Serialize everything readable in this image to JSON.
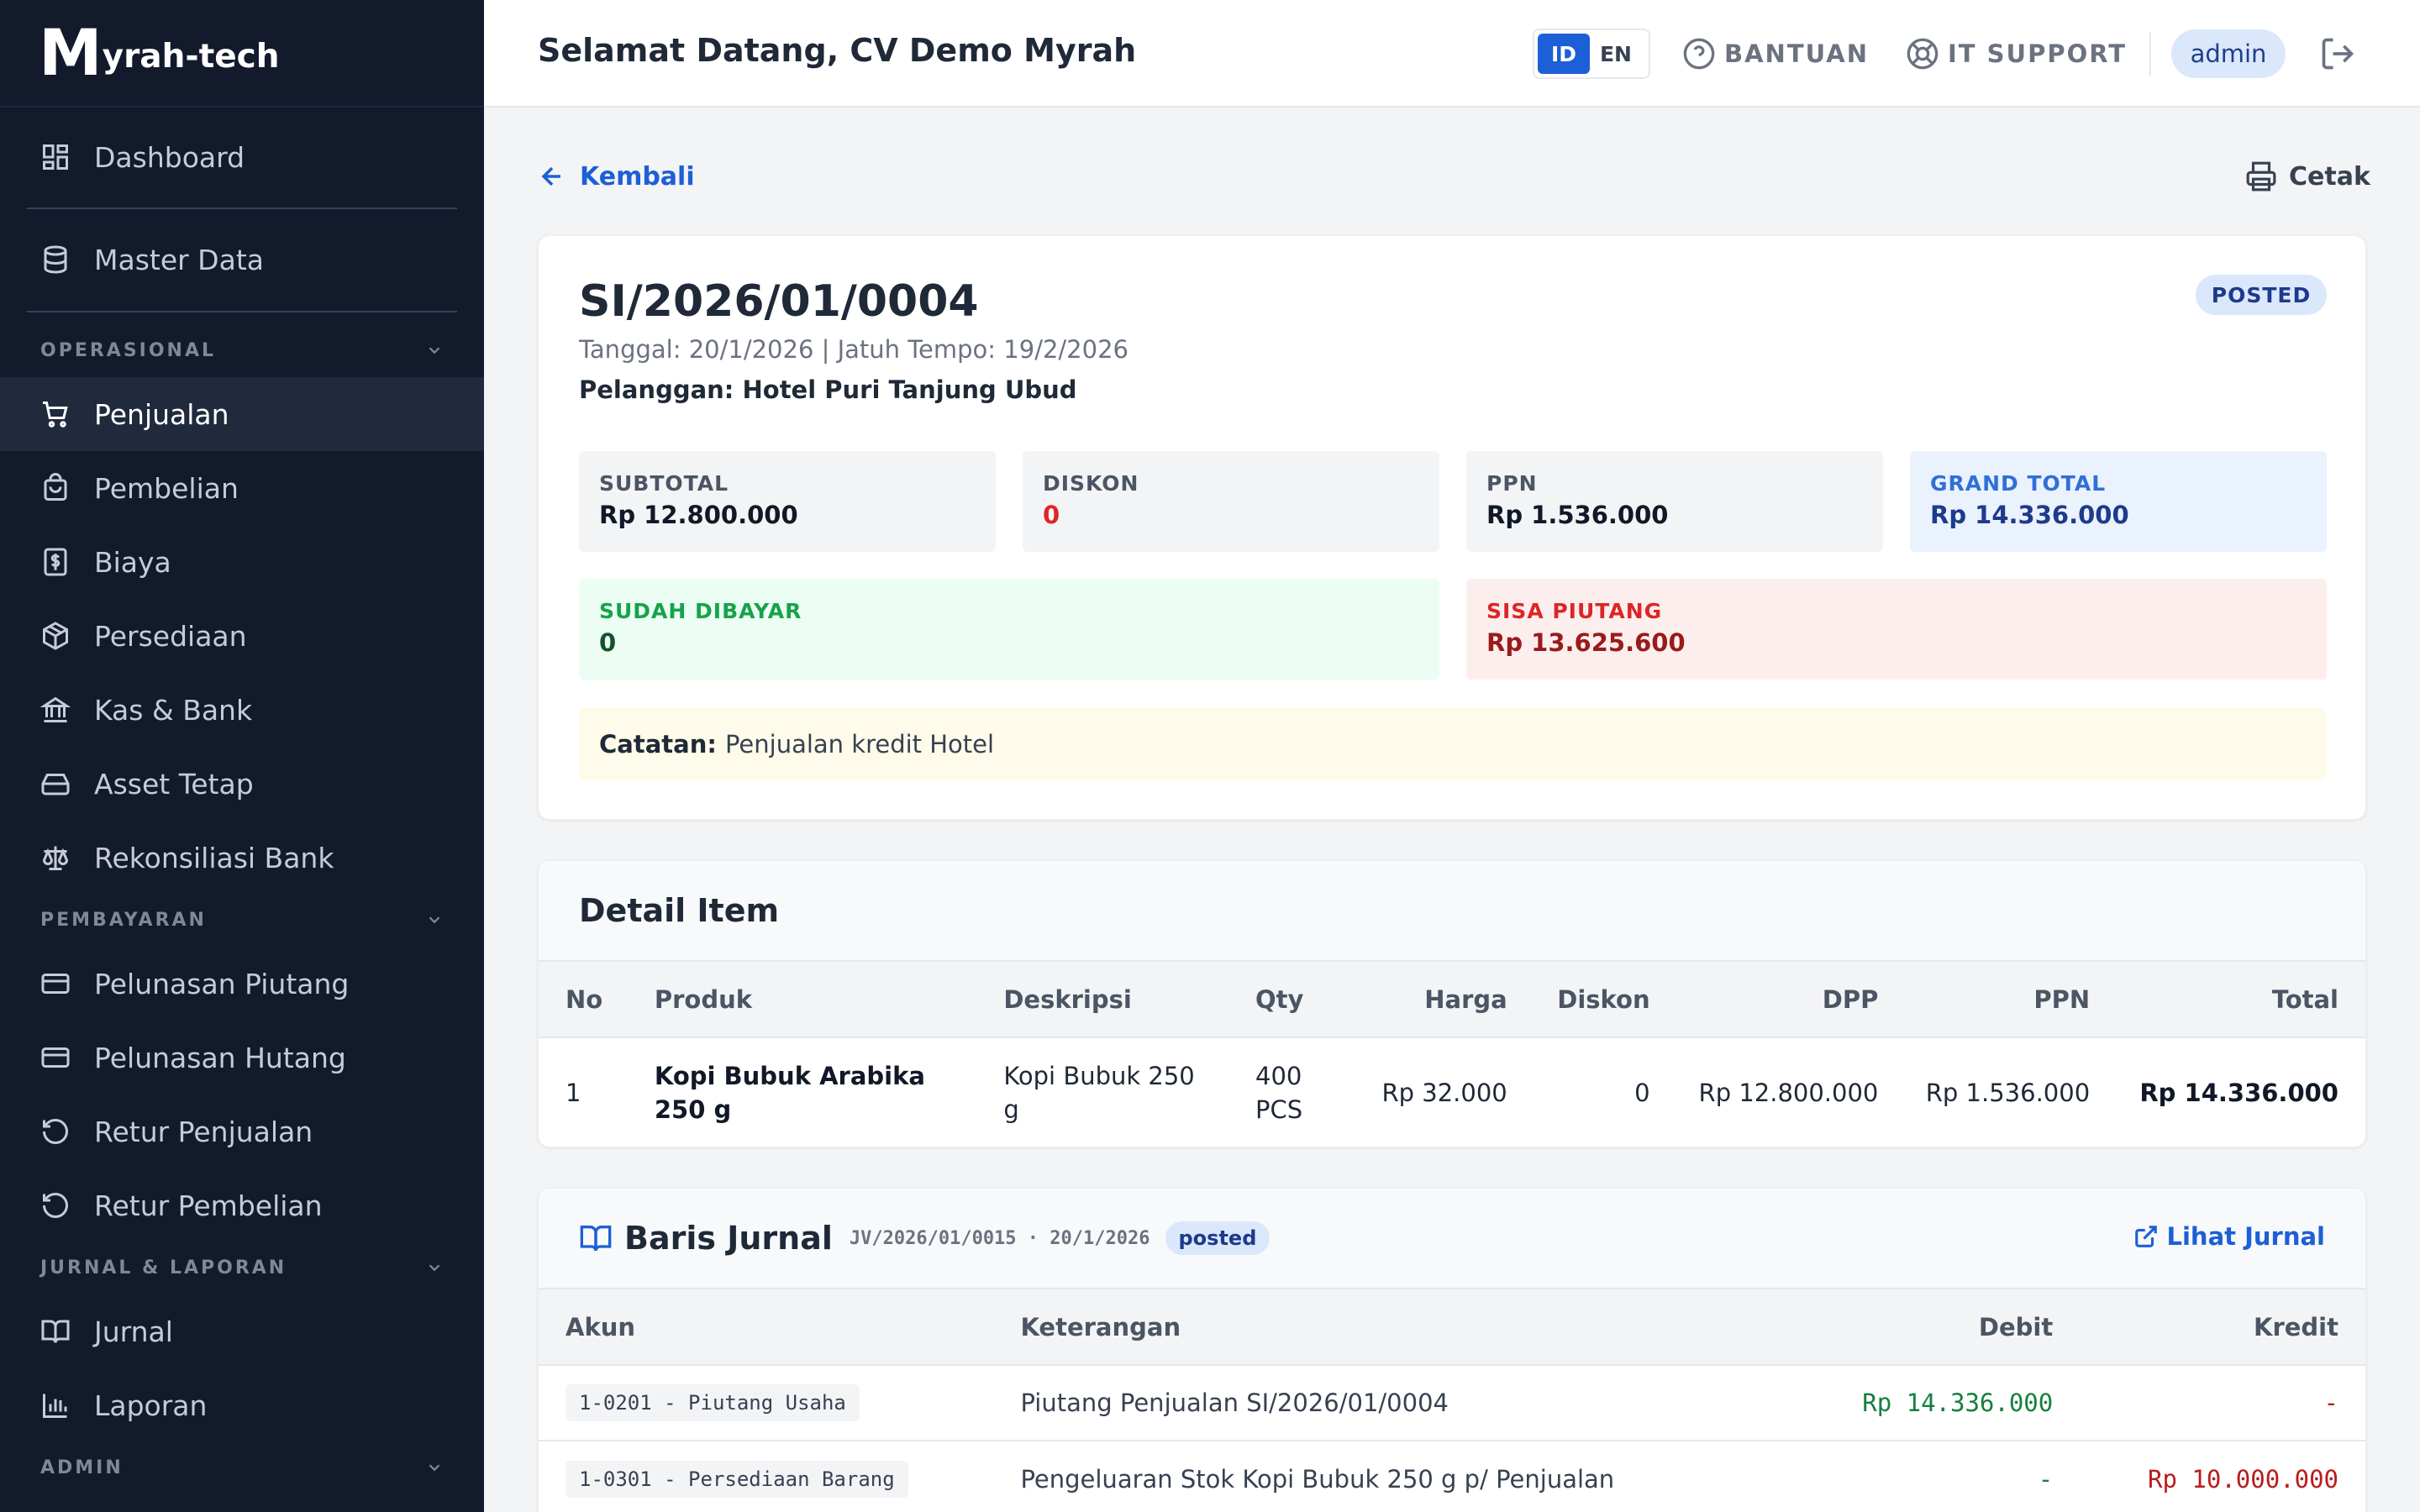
{
  "brand": {
    "logo_letter": "M",
    "name": "yrah-tech"
  },
  "sidebar": {
    "top_items": [
      {
        "label": "Dashboard",
        "icon": "grid-icon"
      },
      {
        "label": "Master Data",
        "icon": "database-icon"
      }
    ],
    "sections": [
      {
        "title": "OPERASIONAL",
        "items": [
          "Penjualan",
          "Pembelian",
          "Biaya",
          "Persediaan",
          "Kas & Bank",
          "Asset Tetap",
          "Rekonsiliasi Bank"
        ]
      },
      {
        "title": "PEMBAYARAN",
        "items": [
          "Pelunasan Piutang",
          "Pelunasan Hutang",
          "Retur Penjualan",
          "Retur Pembelian"
        ]
      },
      {
        "title": "JURNAL & LAPORAN",
        "items": [
          "Jurnal",
          "Laporan"
        ]
      },
      {
        "title": "ADMIN",
        "items": []
      }
    ],
    "active_item": "Penjualan"
  },
  "header": {
    "welcome": "Selamat Datang, CV Demo Myrah",
    "lang": {
      "id": "ID",
      "en": "EN",
      "active": "ID"
    },
    "help_label": "BANTUAN",
    "support_label": "IT SUPPORT",
    "user": "admin"
  },
  "actions": {
    "back_label": "Kembali",
    "print_label": "Cetak"
  },
  "invoice": {
    "number": "SI/2026/01/0004",
    "dates": "Tanggal: 20/1/2026 | Jatuh Tempo: 19/2/2026",
    "customer": "Pelanggan: Hotel Puri Tanjung Ubud",
    "status": "POSTED",
    "summary": {
      "subtotal_label": "SUBTOTAL",
      "subtotal": "Rp 12.800.000",
      "discount_label": "DISKON",
      "discount": "0",
      "ppn_label": "PPN",
      "ppn": "Rp 1.536.000",
      "grand_label": "GRAND TOTAL",
      "grand": "Rp 14.336.000",
      "paid_label": "SUDAH DIBAYAR",
      "paid": "0",
      "remaining_label": "SISA PIUTANG",
      "remaining": "Rp 13.625.600"
    },
    "note_label": "Catatan:",
    "note": "Penjualan kredit Hotel"
  },
  "detail": {
    "title": "Detail Item",
    "columns": {
      "no": "No",
      "product": "Produk",
      "desc": "Deskripsi",
      "qty": "Qty",
      "price": "Harga",
      "disc": "Diskon",
      "dpp": "DPP",
      "ppn": "PPN",
      "total": "Total"
    },
    "rows": [
      {
        "no": "1",
        "product": "Kopi Bubuk Arabika 250 g",
        "desc": "Kopi Bubuk 250 g",
        "qty": "400 PCS",
        "price": "Rp 32.000",
        "disc": "0",
        "dpp": "Rp 12.800.000",
        "ppn": "Rp 1.536.000",
        "total": "Rp 14.336.000"
      }
    ]
  },
  "journal": {
    "title": "Baris Jurnal",
    "ref": "JV/2026/01/0015 · 20/1/2026",
    "status": "posted",
    "link_label": "Lihat Jurnal",
    "columns": {
      "account": "Akun",
      "desc": "Keterangan",
      "debit": "Debit",
      "credit": "Kredit"
    },
    "rows": [
      {
        "account": "1-0201 - Piutang Usaha",
        "desc": "Piutang Penjualan SI/2026/01/0004",
        "debit": "Rp 14.336.000",
        "credit": "-"
      },
      {
        "account": "1-0301 - Persediaan Barang",
        "desc": "Pengeluaran Stok Kopi Bubuk 250 g p/ Penjualan",
        "debit": "-",
        "credit": "Rp 10.000.000"
      }
    ]
  },
  "colors": {
    "sidebar_bg": "#121a2c",
    "accent": "#1d5fd6",
    "debit": "#15803d",
    "credit": "#b91c1c"
  }
}
